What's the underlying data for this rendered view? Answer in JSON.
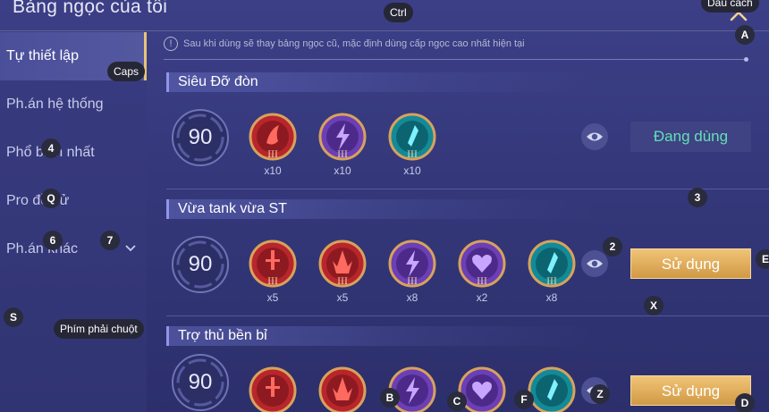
{
  "header": {
    "title": "Bảng ngọc của tôi"
  },
  "sidebar": {
    "items": [
      {
        "label": "Tự thiết lập",
        "active": true
      },
      {
        "label": "Ph.án hệ thống"
      },
      {
        "label": "Phổ biến nhất"
      },
      {
        "label": "Pro đề cử"
      },
      {
        "label": "Ph.án khác"
      }
    ]
  },
  "notice": {
    "icon": "!",
    "text": "Sau khi dùng sẽ thay bảng ngọc cũ, mặc định dùng cấp ngọc cao nhất hiện tại"
  },
  "pages": [
    {
      "name": "Siêu Đỡ đòn",
      "level": "90",
      "runes": [
        {
          "color": "red",
          "icon": "claw-icon",
          "tier": "III",
          "count": "x10"
        },
        {
          "color": "purple",
          "icon": "lightning-icon",
          "tier": "III",
          "count": "x10"
        },
        {
          "color": "teal",
          "icon": "crystal-icon",
          "tier": "III",
          "count": "x10"
        }
      ],
      "action_label": "Đang dùng"
    },
    {
      "name": "Vừa tank vừa ST",
      "level": "90",
      "runes": [
        {
          "color": "red",
          "icon": "sword-icon",
          "tier": "III",
          "count": "x5"
        },
        {
          "color": "red",
          "icon": "flame-icon",
          "tier": "III",
          "count": "x5"
        },
        {
          "color": "purple",
          "icon": "lightning-icon",
          "tier": "III",
          "count": "x8"
        },
        {
          "color": "purple",
          "icon": "heart-icon",
          "tier": "III",
          "count": "x2"
        },
        {
          "color": "teal",
          "icon": "crystal-icon",
          "tier": "III",
          "count": "x8"
        }
      ],
      "action_label": "Sử dụng"
    },
    {
      "name": "Trợ thủ bền bỉ",
      "level": "90",
      "runes": [
        {
          "color": "red",
          "icon": "sword-icon"
        },
        {
          "color": "red",
          "icon": "flame-icon"
        },
        {
          "color": "purple",
          "icon": "lightning-icon"
        },
        {
          "color": "purple",
          "icon": "heart-icon"
        },
        {
          "color": "teal",
          "icon": "crystal-icon"
        }
      ],
      "action_label": "Sử dụng"
    }
  ],
  "key_hints": {
    "ctrl": "Ctrl",
    "space": "Dấu cách",
    "a": "A",
    "caps": "Caps",
    "k4": "4",
    "q": "Q",
    "k6": "6",
    "k7": "7",
    "s": "S",
    "right_click": "Phím phải chuột",
    "k3": "3",
    "k2": "2",
    "x": "X",
    "e": "E",
    "b": "B",
    "c": "C",
    "f": "F",
    "z": "Z",
    "d": "D"
  },
  "colors": {
    "accent_gold": "#e6c47a",
    "using_green": "#62e0b5",
    "button_gold": "#e0ae5e",
    "rune_red": "#b8262c",
    "rune_purple": "#6b3fb5",
    "rune_teal": "#138a98"
  }
}
